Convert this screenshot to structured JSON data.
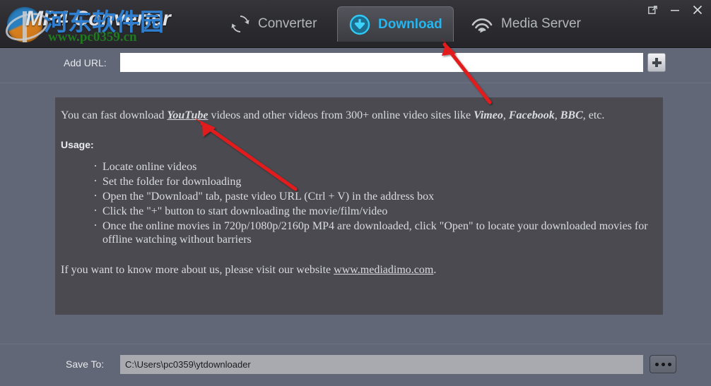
{
  "window": {
    "app_title": "MP4 Converter",
    "controls": [
      {
        "name": "restore-window-button",
        "icon": "external-link-icon",
        "glyph": "↗"
      },
      {
        "name": "minimize-window-button",
        "icon": "minimize-icon",
        "glyph": "─"
      },
      {
        "name": "close-window-button",
        "icon": "close-icon",
        "glyph": "✕"
      }
    ]
  },
  "watermark": {
    "cn_text": "河东软件园",
    "url_text": "www.pc0359.cn",
    "cn_color": "#2f7fd0",
    "url_color": "#1f7a1f"
  },
  "tabs": [
    {
      "id": "converter",
      "label": "Converter",
      "icon": "refresh-icon",
      "active": false
    },
    {
      "id": "download",
      "label": "Download",
      "icon": "download-icon",
      "active": true
    },
    {
      "id": "mediaserver",
      "label": "Media Server",
      "icon": "cast-icon",
      "active": false
    }
  ],
  "url_row": {
    "label": "Add URL:",
    "value": "",
    "placeholder": "",
    "add_button_name": "add-url-button"
  },
  "panel": {
    "intro": {
      "before": "You can fast download ",
      "youtube": "YouTube",
      "middle": " videos and other videos from 300+ online video sites like ",
      "sites": [
        "Vimeo",
        "Facebook",
        "BBC"
      ],
      "after": ", etc."
    },
    "usage_heading": "Usage:",
    "bullets": [
      "Locate online videos",
      "Set the folder for downloading",
      "Open the \"Download\" tab, paste video URL (Ctrl + V) in the address box",
      "Click the \"+\" button to start downloading the movie/film/video",
      "Once the online movies in 720p/1080p/2160p MP4 are downloaded, click \"Open\" to locate your downloaded movies for offline watching without barriers"
    ],
    "outro_before": "If you want to know more about us, please visit our website ",
    "outro_link": "www.mediadimo.com",
    "outro_after": "."
  },
  "save_row": {
    "label": "Save To:",
    "value": "C:\\Users\\pc0359\\ytdownloader",
    "placeholder": "",
    "browse_label": "...",
    "browse_button_name": "browse-folder-button"
  },
  "colors": {
    "window_bg": "#616776",
    "titlebar_bg": "#2c2c31",
    "panel_bg": "#4a4a50",
    "accent": "#26b6ef",
    "annotation_arrow": "#e21b1b"
  }
}
